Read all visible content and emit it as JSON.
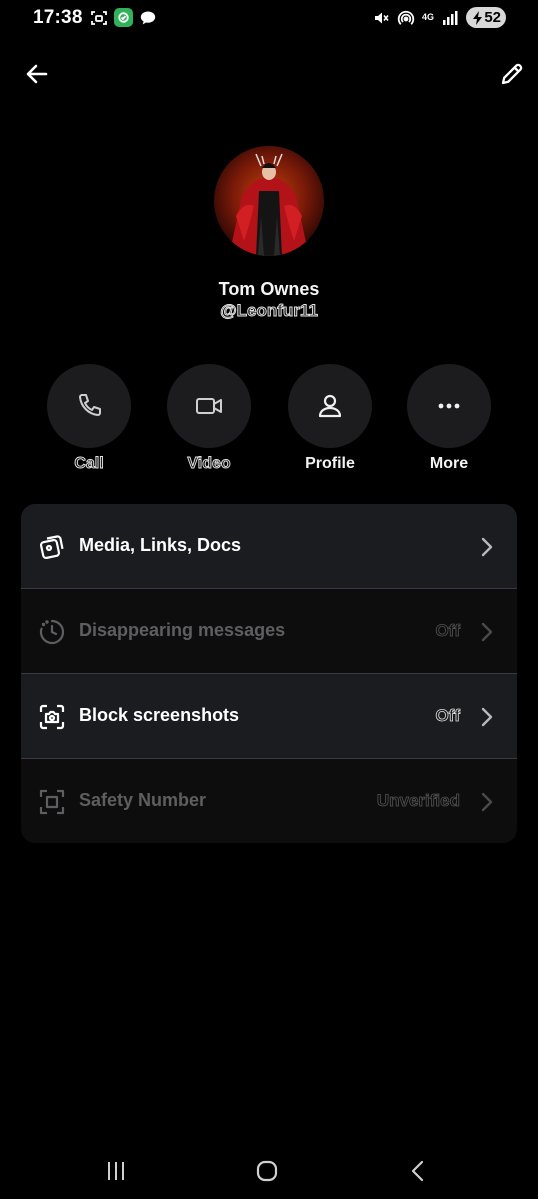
{
  "status_bar": {
    "time": "17:38",
    "network": "4G",
    "battery": "52"
  },
  "contact": {
    "name": "Tom Ownes",
    "handle": "@Leonfur11"
  },
  "actions": [
    {
      "label": "Call",
      "icon": "phone-icon"
    },
    {
      "label": "Video",
      "icon": "video-icon"
    },
    {
      "label": "Profile",
      "icon": "person-icon"
    },
    {
      "label": "More",
      "icon": "more-dots-icon"
    }
  ],
  "settings": [
    {
      "label": "Media, Links, Docs",
      "value": "",
      "icon": "media-icon",
      "enabled": true
    },
    {
      "label": "Disappearing messages",
      "value": "Off",
      "icon": "timer-icon",
      "enabled": false
    },
    {
      "label": "Block screenshots",
      "value": "Off",
      "icon": "screenshot-camera-icon",
      "enabled": true
    },
    {
      "label": "Safety Number",
      "value": "Unverified",
      "icon": "safety-number-icon",
      "enabled": false
    }
  ],
  "colors": {
    "background": "#000000",
    "circle_button": "#1c1c1e",
    "card_row_active": "#1b1c1f",
    "text_dim": "#5e5e61"
  }
}
